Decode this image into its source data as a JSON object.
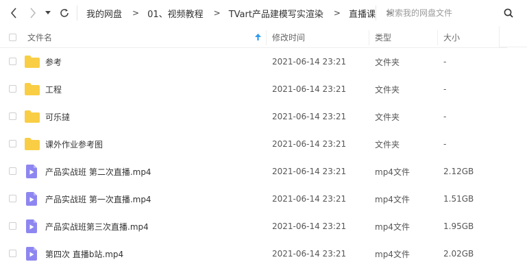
{
  "toolbar": {
    "breadcrumbs": [
      "我的网盘",
      "01、视频教程",
      "TVart产品建模写实渲染",
      "直播课"
    ],
    "breadcrumb_separator": ">",
    "search_placeholder": "搜索我的网盘文件"
  },
  "columns": {
    "name": "文件名",
    "modified": "修改时间",
    "type": "类型",
    "size": "大小"
  },
  "files": [
    {
      "name": "参考",
      "modified": "2021-06-14 23:21",
      "type": "文件夹",
      "size": "-",
      "icon": "folder-icon"
    },
    {
      "name": "工程",
      "modified": "2021-06-14 23:21",
      "type": "文件夹",
      "size": "-",
      "icon": "folder-icon"
    },
    {
      "name": "可乐撻",
      "modified": "2021-06-14 23:21",
      "type": "文件夹",
      "size": "-",
      "icon": "folder-icon"
    },
    {
      "name": "课外作业参考图",
      "modified": "2021-06-14 23:21",
      "type": "文件夹",
      "size": "-",
      "icon": "folder-icon"
    },
    {
      "name": "产品实战班 第二次直播.mp4",
      "modified": "2021-06-14 23:21",
      "type": "mp4文件",
      "size": "2.12GB",
      "icon": "video-file-icon"
    },
    {
      "name": "产品实战班 第一次直播.mp4",
      "modified": "2021-06-14 23:21",
      "type": "mp4文件",
      "size": "1.51GB",
      "icon": "video-file-icon"
    },
    {
      "name": "产品实战班第三次直播.mp4",
      "modified": "2021-06-14 23:21",
      "type": "mp4文件",
      "size": "1.95GB",
      "icon": "video-file-icon"
    },
    {
      "name": "第四次 直播b站.mp4",
      "modified": "2021-06-14 23:21",
      "type": "mp4文件",
      "size": "2.02GB",
      "icon": "video-file-icon"
    }
  ],
  "colors": {
    "folder": "#F9CE45",
    "video_file": "#8E86F0",
    "sort_arrow": "#2E9BF0"
  }
}
